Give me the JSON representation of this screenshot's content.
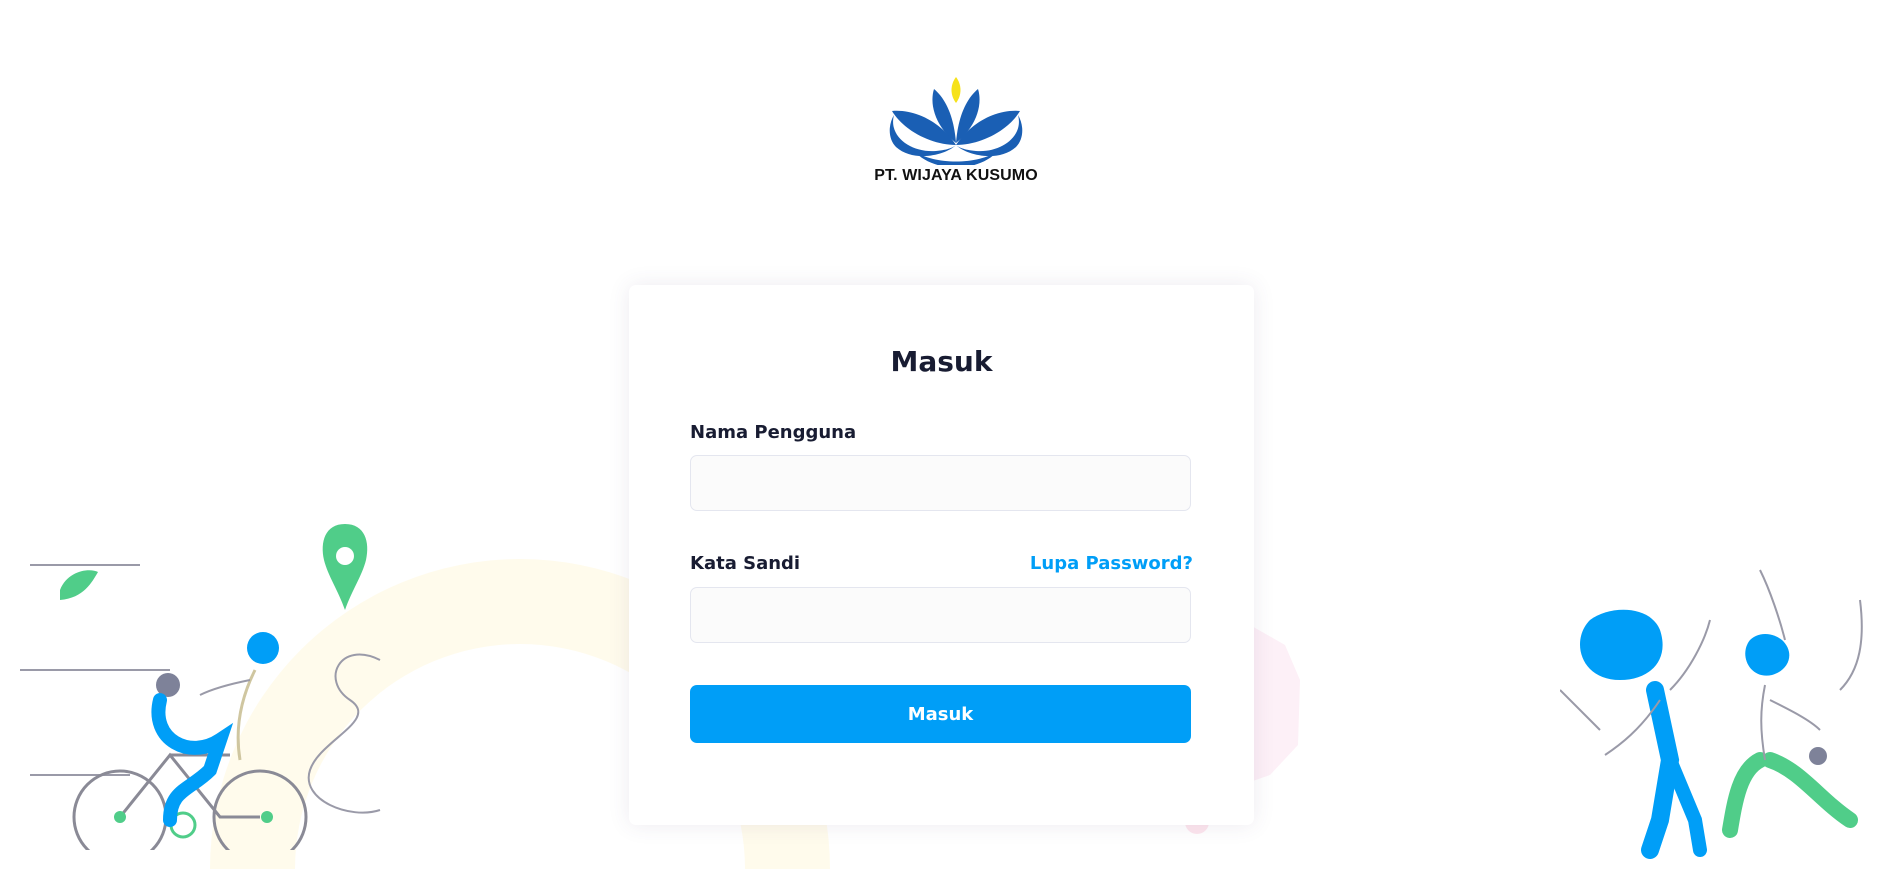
{
  "brand": {
    "company_name": "PT. WIJAYA KUSUMO",
    "logo_icon": "lotus-logo-icon",
    "primary_color": "#1a5fb4",
    "accent_color": "#f6e21a"
  },
  "login": {
    "title": "Masuk",
    "username_label": "Nama Pengguna",
    "username_value": "",
    "password_label": "Kata Sandi",
    "password_value": "",
    "forgot_link": "Lupa Password?",
    "submit_label": "Masuk",
    "button_color": "#009ef7"
  },
  "illustrations": {
    "left": "cyclists-illustration",
    "right": "dancing-people-illustration"
  }
}
